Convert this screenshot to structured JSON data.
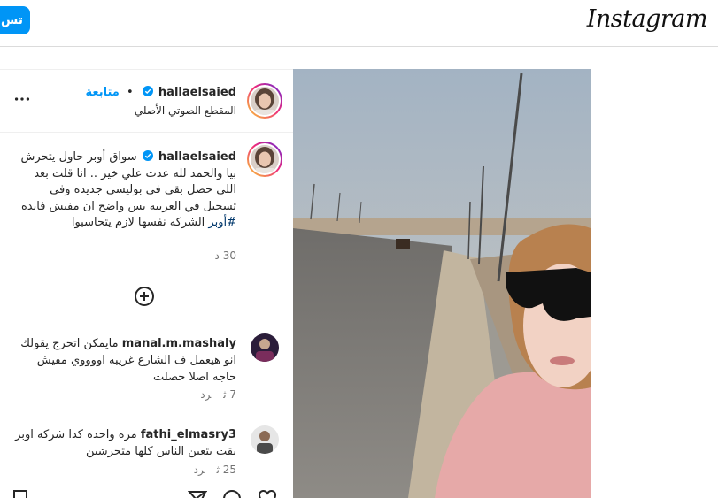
{
  "app": {
    "brand": "Instagram",
    "signup_label": "تس"
  },
  "post": {
    "username": "hallaelsaied",
    "follow_label": "متابعة",
    "separator": "•",
    "audio_label": "المقطع الصوتي الأصلي",
    "caption_text": "سواق أوبر حاول يتحرش بيا والحمد لله عدت علي خير .. انا قلت بعد اللي حصل بقي في بوليسي جديده وفي تسجيل في العربيه بس واضح ان مفيش فايده ",
    "caption_hashtag": "#أوبر",
    "caption_tail": " الشركه نفسها لازم يتحاسبوا",
    "caption_time": "30 د"
  },
  "comments": [
    {
      "username": "manal.m.mashaly",
      "text": "مايمكن اتحرج يقولك انو هيعمل ف الشارع غريبه اووووي مفيش حاجه اصلا حصلت",
      "time": "7 ث",
      "reply_label": "رد"
    },
    {
      "username": "fathi_elmasry3",
      "text": "مره واحده كدا شركه اوبر بقت بتعين الناس كلها متحرشين",
      "time": "25 ث",
      "reply_label": "رد"
    }
  ],
  "icons": {
    "more": "more-horizontal-icon",
    "verified": "verified-badge-icon",
    "add": "plus-circle-icon",
    "like": "heart-icon",
    "comment": "comment-icon",
    "share": "send-icon",
    "save": "bookmark-icon"
  },
  "colors": {
    "accent": "#0095f6",
    "verified": "#0095f6",
    "hashtag": "#00376b",
    "muted": "#737373"
  }
}
